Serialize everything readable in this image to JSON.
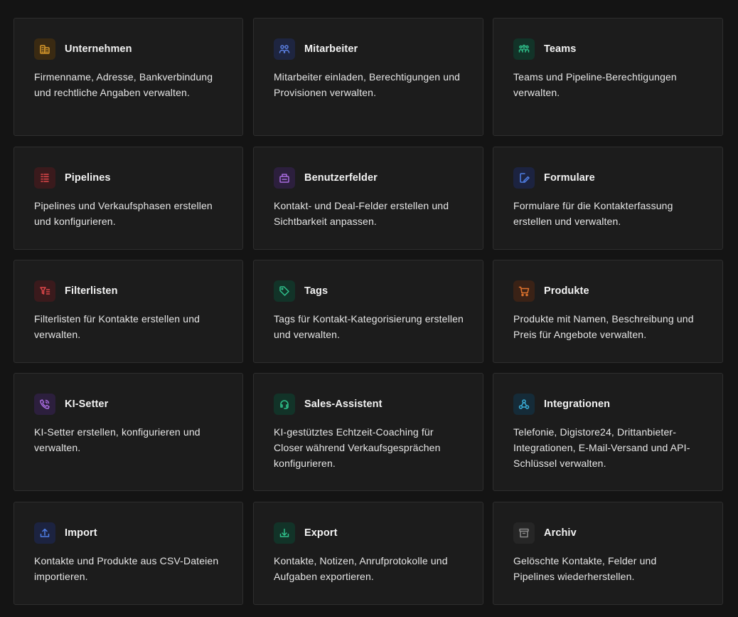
{
  "cards": [
    {
      "title": "Unternehmen",
      "description": "Firmenname, Adresse, Bankverbindung und rechtliche Angaben verwalten.",
      "icon": "building-icon",
      "color": "#d99a2b"
    },
    {
      "title": "Mitarbeiter",
      "description": "Mitarbeiter einladen, Berechtigungen und Provisionen verwalten.",
      "icon": "users-icon",
      "color": "#5b7fe0"
    },
    {
      "title": "Teams",
      "description": "Teams und Pipeline-Berechtigungen verwalten.",
      "icon": "teams-icon",
      "color": "#2fbf8a"
    },
    {
      "title": "Pipelines",
      "description": "Pipelines und Verkaufsphasen erstellen und konfigurieren.",
      "icon": "pipeline-icon",
      "color": "#e0474a"
    },
    {
      "title": "Benutzerfelder",
      "description": "Kontakt- und Deal-Felder erstellen und Sichtbarkeit anpassen.",
      "icon": "fields-icon",
      "color": "#a86bdf"
    },
    {
      "title": "Formulare",
      "description": "Formulare für die Kontakterfassung erstellen und verwalten.",
      "icon": "form-edit-icon",
      "color": "#4f7fe6"
    },
    {
      "title": "Filterlisten",
      "description": "Filterlisten für Kontakte erstellen und verwalten.",
      "icon": "filter-list-icon",
      "color": "#e0474a"
    },
    {
      "title": "Tags",
      "description": "Tags für Kontakt-Kategorisierung erstellen und verwalten.",
      "icon": "tag-icon",
      "color": "#2fbf8a"
    },
    {
      "title": "Produkte",
      "description": "Produkte mit Namen, Beschreibung und Preis für Angebote verwalten.",
      "icon": "cart-icon",
      "color": "#e0742e"
    },
    {
      "title": "KI-Setter",
      "description": "KI-Setter erstellen, konfigurieren und verwalten.",
      "icon": "phone-call-icon",
      "color": "#a86bdf"
    },
    {
      "title": "Sales-Assistent",
      "description": "KI-gestütztes Echtzeit-Coaching für Closer während Verkaufsgesprächen konfigurieren.",
      "icon": "headset-icon",
      "color": "#2fbf8a"
    },
    {
      "title": "Integrationen",
      "description": "Telefonie, Digistore24, Drittanbieter-Integrationen, E-Mail-Versand und API-Schlüssel verwalten.",
      "icon": "webhook-icon",
      "color": "#3aaed8"
    },
    {
      "title": "Import",
      "description": "Kontakte und Produkte aus CSV-Dateien importieren.",
      "icon": "upload-icon",
      "color": "#4f7fe6"
    },
    {
      "title": "Export",
      "description": "Kontakte, Notizen, Anrufprotokolle und Aufgaben exportieren.",
      "icon": "download-icon",
      "color": "#2fbf8a"
    },
    {
      "title": "Archiv",
      "description": "Gelöschte Kontakte, Felder und Pipelines wiederherstellen.",
      "icon": "archive-icon",
      "color": "#8a8a8a"
    }
  ]
}
